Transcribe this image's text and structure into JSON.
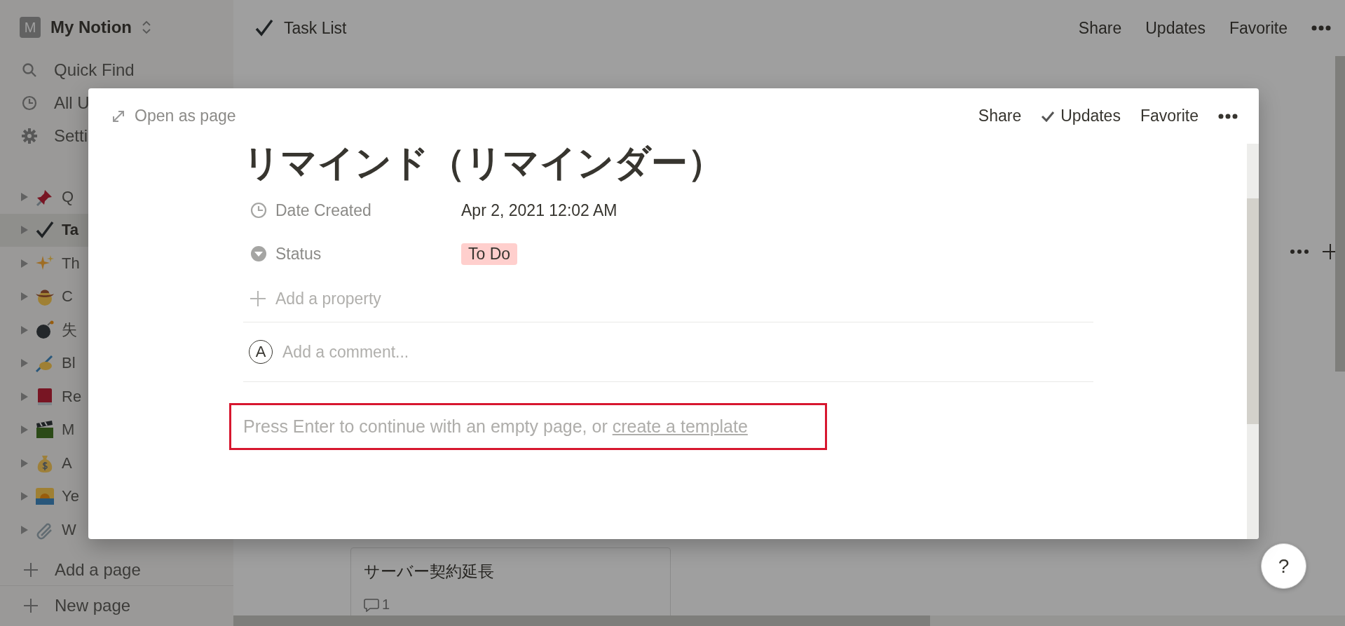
{
  "sidebar": {
    "workspace": {
      "initial": "M",
      "name": "My Notion"
    },
    "nav": [
      {
        "kind": "search",
        "label": "Quick Find"
      },
      {
        "kind": "clock",
        "label": "All U"
      },
      {
        "kind": "gear",
        "label": "Setti"
      }
    ],
    "pages": [
      {
        "kind": "pin",
        "label": "Q",
        "selected": false
      },
      {
        "kind": "check",
        "label": "Ta",
        "selected": true
      },
      {
        "kind": "sparkles",
        "label": "Th",
        "selected": false
      },
      {
        "kind": "hat",
        "label": "C",
        "selected": false
      },
      {
        "kind": "bomb",
        "label": "失",
        "selected": false
      },
      {
        "kind": "pen",
        "label": "Bl",
        "selected": false
      },
      {
        "kind": "book",
        "label": "Re",
        "selected": false
      },
      {
        "kind": "clapper",
        "label": "M",
        "selected": false
      },
      {
        "kind": "moneybag",
        "label": "A",
        "selected": false
      },
      {
        "kind": "sunrise",
        "label": "Ye",
        "selected": false
      },
      {
        "kind": "paperclip",
        "label": "W",
        "selected": false
      }
    ],
    "add_page": "Add a page",
    "new_page": "New page"
  },
  "topbar": {
    "title": "Task List",
    "actions": [
      "Share",
      "Updates",
      "Favorite"
    ]
  },
  "board": {
    "cards": [
      {
        "title": "サーバー契約延長",
        "comments": "1"
      }
    ]
  },
  "help": "?",
  "modal": {
    "open_as_page": "Open as page",
    "actions": [
      {
        "label": "Share",
        "checked": false
      },
      {
        "label": "Updates",
        "checked": true
      },
      {
        "label": "Favorite",
        "checked": false
      }
    ],
    "title": "リマインド（リマインダー）",
    "properties": [
      {
        "kind": "date",
        "name": "Date Created",
        "value": "Apr 2, 2021 12:02 AM"
      },
      {
        "kind": "select",
        "name": "Status",
        "value": "To Do",
        "color": "#ffcfcd"
      }
    ],
    "add_property": "Add a property",
    "comment": {
      "avatar": "A",
      "placeholder": "Add a comment..."
    },
    "empty_hint": {
      "text": "Press Enter to continue with an empty page, or ",
      "link": "create a template",
      "highlighted": true
    }
  }
}
